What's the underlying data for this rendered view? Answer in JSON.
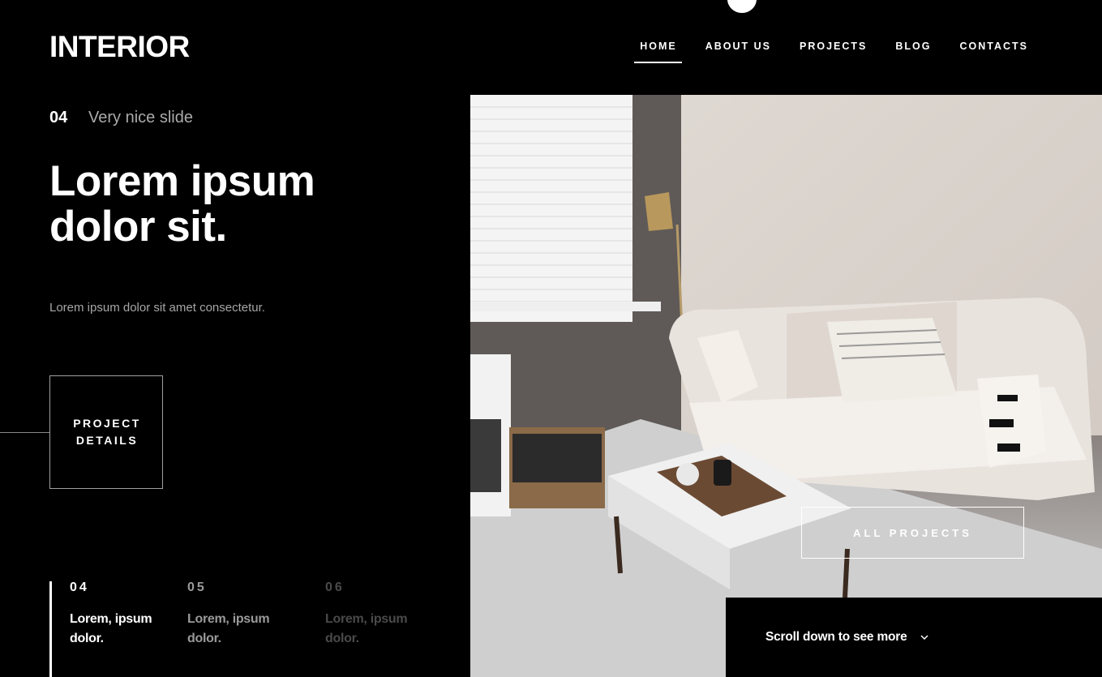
{
  "header": {
    "logo": "INTERIOR",
    "nav": [
      {
        "label": "HOME",
        "active": true
      },
      {
        "label": "ABOUT US",
        "active": false
      },
      {
        "label": "PROJECTS",
        "active": false
      },
      {
        "label": "BLOG",
        "active": false
      },
      {
        "label": "CONTACTS",
        "active": false
      }
    ]
  },
  "hero": {
    "slide_number": "04",
    "slide_subtitle": "Very nice slide",
    "headline": "Lorem ipsum dolor sit.",
    "lead": "Lorem ipsum dolor sit amet consectetur.",
    "details_button": "PROJECT DETAILS"
  },
  "thumbnails": [
    {
      "number": "04",
      "title": "Lorem, ipsum dolor."
    },
    {
      "number": "05",
      "title": "Lorem, ipsum dolor."
    },
    {
      "number": "06",
      "title": "Lorem, ipsum dolor."
    }
  ],
  "photo": {
    "all_projects_button": "ALL PROJECTS",
    "scroll_hint": "Scroll down to see more",
    "scroll_icon": "chevron-down-icon"
  }
}
